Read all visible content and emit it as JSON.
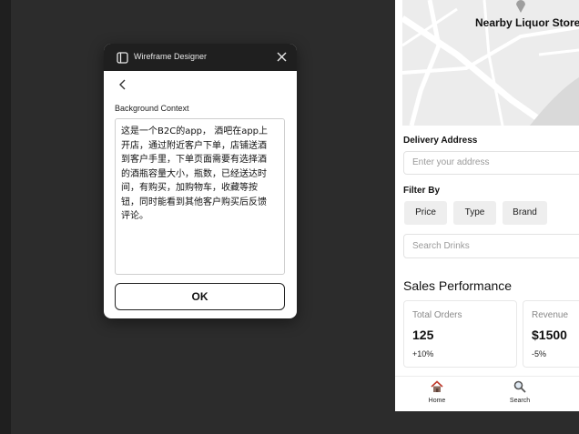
{
  "dialog": {
    "title": "Wireframe Designer",
    "app_icon": "notebook-icon",
    "close_icon": "close-icon",
    "back_icon": "chevron-left-icon",
    "field_label": "Background Context",
    "textarea_value": "这是一个B2C的app， 酒吧在app上\n开店，通过附近客户下单，店铺送酒\n到客户手里，下单页面需要有选择酒\n的酒瓶容量大小，瓶数，已经送达时\n间，有购买，加购物车，收藏等按\n钮，同时能看到其他客户购买后反馈\n评论。",
    "ok_label": "OK"
  },
  "phone": {
    "map_title": "Nearby Liquor Stores",
    "map_pin_icon": "map-pin-icon",
    "delivery": {
      "label": "Delivery Address",
      "placeholder": "Enter your address"
    },
    "filter": {
      "label": "Filter By",
      "chips": [
        "Price",
        "Type",
        "Brand"
      ]
    },
    "search_placeholder": "Search Drinks",
    "sales": {
      "title": "Sales Performance",
      "cards": [
        {
          "label": "Total Orders",
          "value": "125",
          "change": "+10%"
        },
        {
          "label": "Revenue",
          "value": "$1500",
          "change": "-5%"
        }
      ]
    },
    "nav": [
      {
        "label": "Home",
        "icon": "home-icon"
      },
      {
        "label": "Search",
        "icon": "search-icon"
      }
    ]
  },
  "colors": {
    "canvas": "#2c2c2c",
    "titlebar": "#1f1f1f",
    "map": "#ececec"
  }
}
